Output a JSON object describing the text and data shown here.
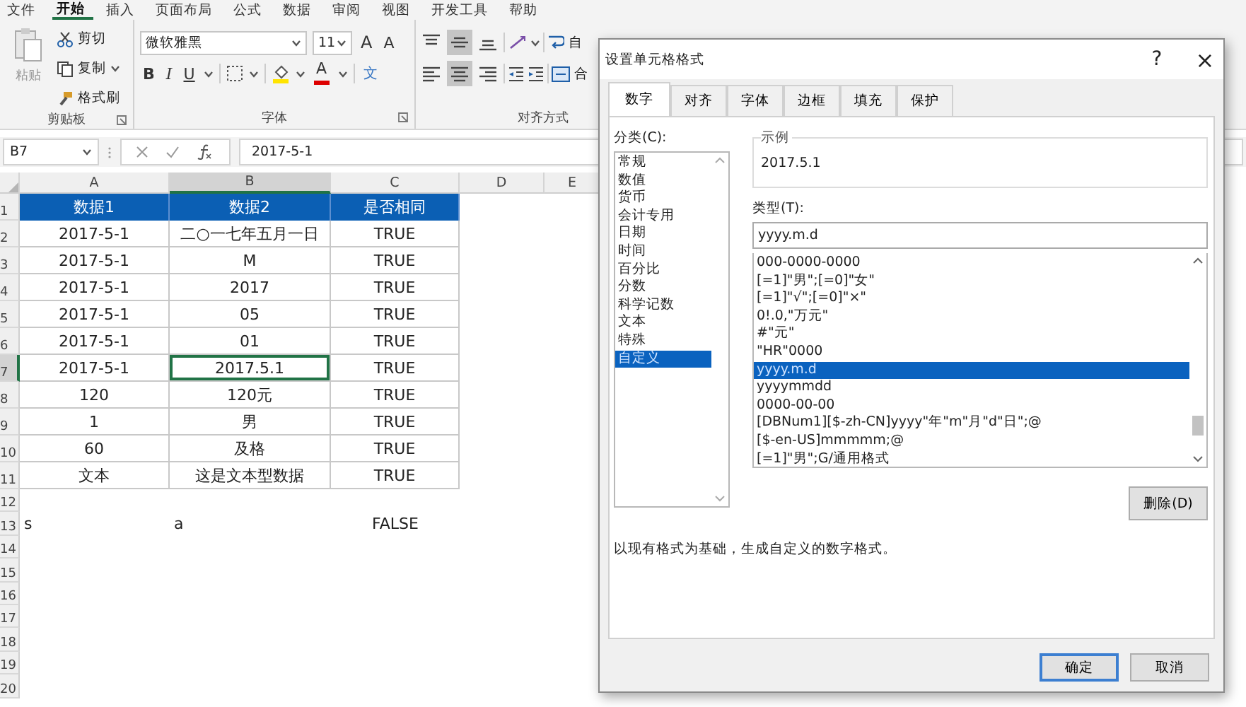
{
  "menu": [
    {
      "label": "文件",
      "selected": false
    },
    {
      "label": "开始",
      "selected": true
    },
    {
      "label": "插入",
      "selected": false
    },
    {
      "label": "页面布局",
      "selected": false
    },
    {
      "label": "公式",
      "selected": false
    },
    {
      "label": "数据",
      "selected": false
    },
    {
      "label": "审阅",
      "selected": false
    },
    {
      "label": "视图",
      "selected": false
    },
    {
      "label": "开发工具",
      "selected": false
    },
    {
      "label": "帮助",
      "selected": false
    }
  ],
  "ribbon": {
    "clipboard": {
      "paste": {
        "label": "粘贴",
        "disabled": true
      },
      "cut": "剪切",
      "copy": "复制",
      "format_painter": "格式刷",
      "label": "剪贴板"
    },
    "font": {
      "font_name": "微软雅黑",
      "font_size": "11",
      "grow": "A",
      "shrink": "A",
      "bold": "B",
      "italic": "I",
      "underline": "U",
      "font_color": "A",
      "phonetic": "文",
      "label": "字体"
    },
    "alignment": {
      "vertical": [
        {
          "kind": "top",
          "selected": false
        },
        {
          "kind": "middle",
          "selected": true
        },
        {
          "kind": "bottom",
          "selected": false
        }
      ],
      "horizontal": [
        {
          "kind": "left",
          "selected": false
        },
        {
          "kind": "center",
          "selected": true
        },
        {
          "kind": "right",
          "selected": false
        }
      ],
      "wrap_text": "自",
      "merge": "合",
      "label": "对齐方式"
    }
  },
  "formula_bar": {
    "name_box": "B7",
    "formula": "2017-5-1"
  },
  "sheet": {
    "columns": [
      {
        "label": "A",
        "selected": false
      },
      {
        "label": "B",
        "selected": true
      },
      {
        "label": "C",
        "selected": false
      },
      {
        "label": "D",
        "selected": false
      },
      {
        "label": "E",
        "selected": false
      }
    ],
    "rows": [
      {
        "number": "1",
        "kind": "header",
        "selected": false,
        "cells": [
          {
            "text": "数据1",
            "selected": false
          },
          {
            "text": "数据2",
            "selected": false
          },
          {
            "text": "是否相同",
            "selected": false
          }
        ]
      },
      {
        "number": "2",
        "kind": "data",
        "selected": false,
        "cells": [
          {
            "text": "2017-5-1",
            "selected": false
          },
          {
            "text": "二○一七年五月一日",
            "selected": false
          },
          {
            "text": "TRUE",
            "selected": false
          }
        ]
      },
      {
        "number": "3",
        "kind": "data",
        "selected": false,
        "cells": [
          {
            "text": "2017-5-1",
            "selected": false
          },
          {
            "text": "M",
            "selected": false
          },
          {
            "text": "TRUE",
            "selected": false
          }
        ]
      },
      {
        "number": "4",
        "kind": "data",
        "selected": false,
        "cells": [
          {
            "text": "2017-5-1",
            "selected": false
          },
          {
            "text": "2017",
            "selected": false
          },
          {
            "text": "TRUE",
            "selected": false
          }
        ]
      },
      {
        "number": "5",
        "kind": "data",
        "selected": false,
        "cells": [
          {
            "text": "2017-5-1",
            "selected": false
          },
          {
            "text": "05",
            "selected": false
          },
          {
            "text": "TRUE",
            "selected": false
          }
        ]
      },
      {
        "number": "6",
        "kind": "data",
        "selected": false,
        "cells": [
          {
            "text": "2017-5-1",
            "selected": false
          },
          {
            "text": "01",
            "selected": false
          },
          {
            "text": "TRUE",
            "selected": false
          }
        ]
      },
      {
        "number": "7",
        "kind": "data",
        "selected": true,
        "cells": [
          {
            "text": "2017-5-1",
            "selected": false
          },
          {
            "text": "2017.5.1",
            "selected": true
          },
          {
            "text": "TRUE",
            "selected": false
          }
        ]
      },
      {
        "number": "8",
        "kind": "data",
        "selected": false,
        "cells": [
          {
            "text": "120",
            "selected": false
          },
          {
            "text": "120元",
            "selected": false
          },
          {
            "text": "TRUE",
            "selected": false
          }
        ]
      },
      {
        "number": "9",
        "kind": "data",
        "selected": false,
        "cells": [
          {
            "text": "1",
            "selected": false
          },
          {
            "text": "男",
            "selected": false
          },
          {
            "text": "TRUE",
            "selected": false
          }
        ]
      },
      {
        "number": "10",
        "kind": "data",
        "selected": false,
        "cells": [
          {
            "text": "60",
            "selected": false
          },
          {
            "text": "及格",
            "selected": false
          },
          {
            "text": "TRUE",
            "selected": false
          }
        ]
      },
      {
        "number": "11",
        "kind": "data",
        "selected": false,
        "cells": [
          {
            "text": "文本",
            "selected": false
          },
          {
            "text": "这是文本型数据",
            "selected": false
          },
          {
            "text": "TRUE",
            "selected": false
          }
        ]
      },
      {
        "number": "12",
        "kind": "plain",
        "selected": false
      },
      {
        "number": "13",
        "kind": "plain",
        "selected": false,
        "cells": [
          {
            "text": "s",
            "kind": "text",
            "selected": false
          },
          {
            "text": "a",
            "kind": "text",
            "selected": false
          },
          {
            "text": "FALSE",
            "kind": "boolean",
            "selected": false
          }
        ]
      },
      {
        "number": "14",
        "kind": "plain",
        "selected": false
      },
      {
        "number": "15",
        "kind": "plain",
        "selected": false
      },
      {
        "number": "16",
        "kind": "plain",
        "selected": false
      },
      {
        "number": "17",
        "kind": "plain",
        "selected": false
      },
      {
        "number": "18",
        "kind": "plain",
        "selected": false
      },
      {
        "number": "19",
        "kind": "plain",
        "selected": false
      },
      {
        "number": "20",
        "kind": "plain",
        "selected": false
      }
    ]
  },
  "dialog": {
    "title": "设置单元格格式",
    "help": "?",
    "close": "×",
    "tabs": [
      {
        "label": "数字",
        "selected": true
      },
      {
        "label": "对齐",
        "selected": false
      },
      {
        "label": "字体",
        "selected": false
      },
      {
        "label": "边框",
        "selected": false
      },
      {
        "label": "填充",
        "selected": false
      },
      {
        "label": "保护",
        "selected": false
      }
    ],
    "category_label": "分类(C):",
    "categories": [
      {
        "label": "常规",
        "selected": false
      },
      {
        "label": "数值",
        "selected": false
      },
      {
        "label": "货币",
        "selected": false
      },
      {
        "label": "会计专用",
        "selected": false
      },
      {
        "label": "日期",
        "selected": false
      },
      {
        "label": "时间",
        "selected": false
      },
      {
        "label": "百分比",
        "selected": false
      },
      {
        "label": "分数",
        "selected": false
      },
      {
        "label": "科学记数",
        "selected": false
      },
      {
        "label": "文本",
        "selected": false
      },
      {
        "label": "特殊",
        "selected": false
      },
      {
        "label": "自定义",
        "selected": true
      }
    ],
    "sample_label": "示例",
    "sample": "2017.5.1",
    "type_label": "类型(T):",
    "type_value": "yyyy.m.d",
    "types": [
      {
        "label": "000-0000-0000",
        "selected": false
      },
      {
        "label": "[=1]\"男\";[=0]\"女\"",
        "selected": false
      },
      {
        "label": "[=1]\"√\";[=0]\"×\"",
        "selected": false
      },
      {
        "label": "0!.0,\"万元\"",
        "selected": false
      },
      {
        "label": "#\"元\"",
        "selected": false
      },
      {
        "label": "\"HR\"0000",
        "selected": false
      },
      {
        "label": "yyyy.m.d",
        "selected": true
      },
      {
        "label": "yyyymmdd",
        "selected": false
      },
      {
        "label": "0000-00-00",
        "selected": false
      },
      {
        "label": "[DBNum1][$-zh-CN]yyyy\"年\"m\"月\"d\"日\";@",
        "selected": false
      },
      {
        "label": "[$-en-US]mmmmm;@",
        "selected": false
      },
      {
        "label": "[=1]\"男\";G/通用格式",
        "selected": false
      }
    ],
    "delete_button": "删除(D)",
    "description": "以现有格式为基础，生成自定义的数字格式。",
    "buttons": [
      {
        "label": "确定",
        "default": true
      },
      {
        "label": "取消",
        "default": false
      }
    ]
  }
}
